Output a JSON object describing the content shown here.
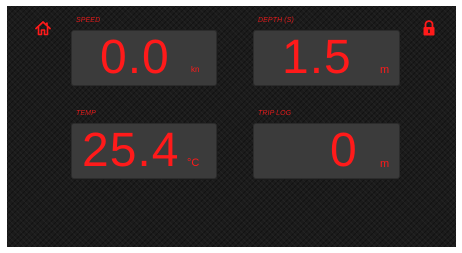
{
  "toolbar": {
    "home_icon": "home-icon",
    "lock_icon": "lock-icon",
    "accent_color": "#ff1a1a"
  },
  "tiles": {
    "speed": {
      "label": "SPEED",
      "value": "0.0",
      "unit": "kn"
    },
    "depth": {
      "label": "DEPTH (S)",
      "value": "1.5",
      "unit": "m"
    },
    "temp": {
      "label": "TEMP",
      "value": "25.4",
      "unit": "°C"
    },
    "trip_log": {
      "label": "TRIP LOG",
      "value": "0",
      "unit": "m"
    }
  }
}
